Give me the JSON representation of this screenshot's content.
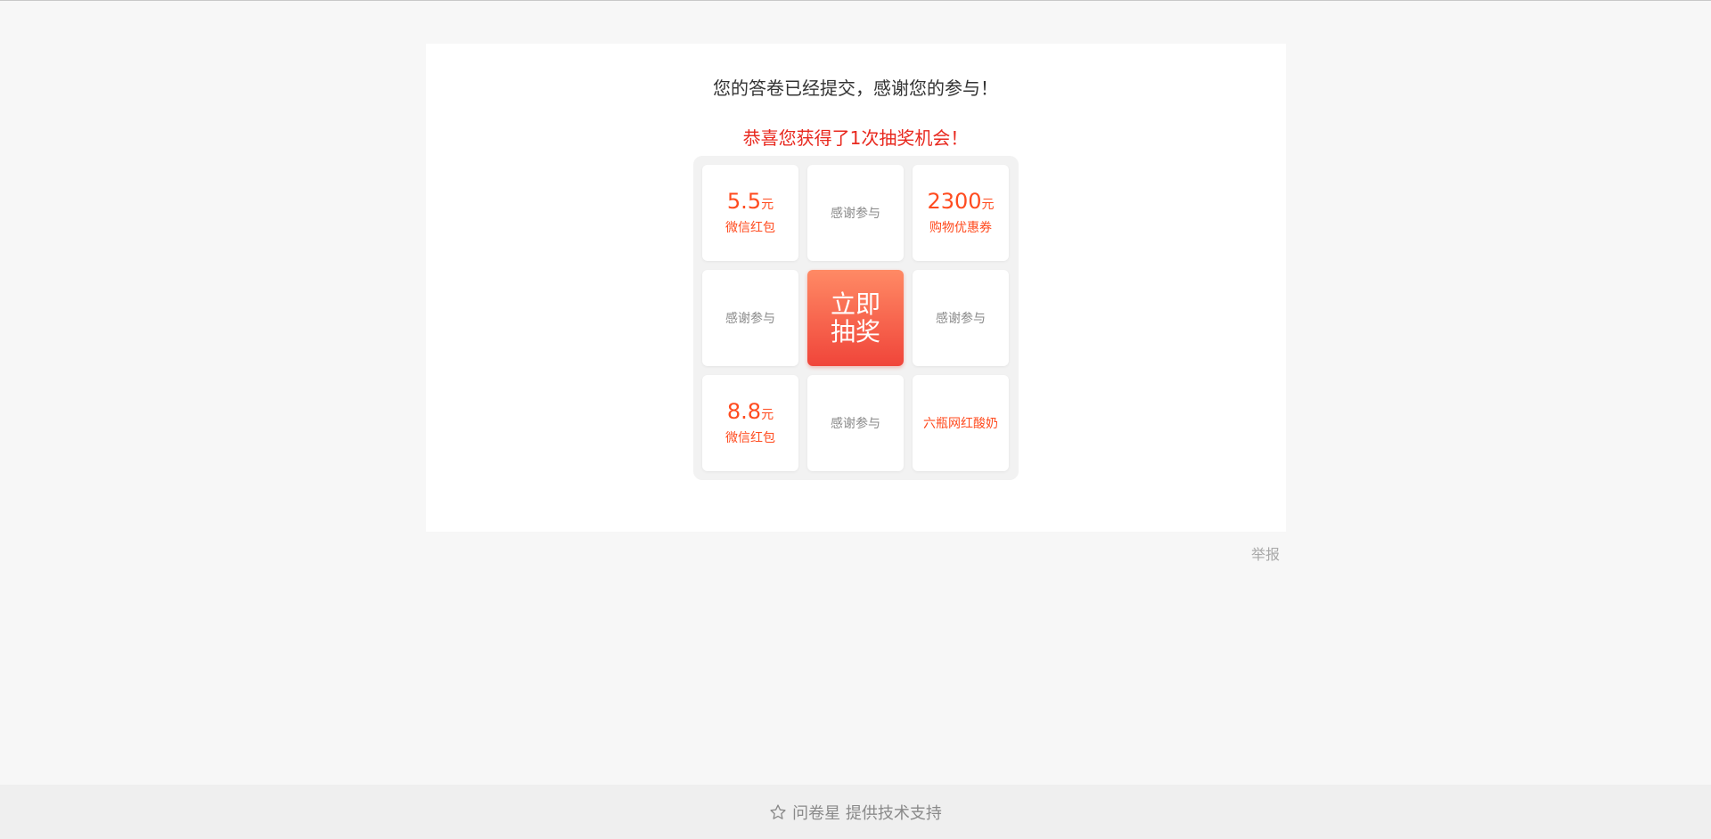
{
  "submission": {
    "thanks_message": "您的答卷已经提交，感谢您的参与！",
    "lottery_message": "恭喜您获得了1次抽奖机会！"
  },
  "lottery": {
    "cells": [
      {
        "amount": "5.5",
        "unit": "元",
        "name": "微信红包"
      },
      {
        "text": "感谢参与"
      },
      {
        "amount": "2300",
        "unit": "元",
        "name": "购物优惠券"
      },
      {
        "text": "感谢参与"
      },
      {
        "button_label": "立即抽奖"
      },
      {
        "text": "感谢参与"
      },
      {
        "amount": "8.8",
        "unit": "元",
        "name": "微信红包"
      },
      {
        "text": "感谢参与"
      },
      {
        "prize": "六瓶网红酸奶"
      }
    ]
  },
  "report_label": "举报",
  "footer": {
    "text": "问卷星 提供技术支持",
    "icon": "star-icon"
  },
  "colors": {
    "prize": "#ff4b1f",
    "congrats": "#e8281e",
    "button_top": "#ff8a65",
    "button_bottom": "#f0453a"
  }
}
